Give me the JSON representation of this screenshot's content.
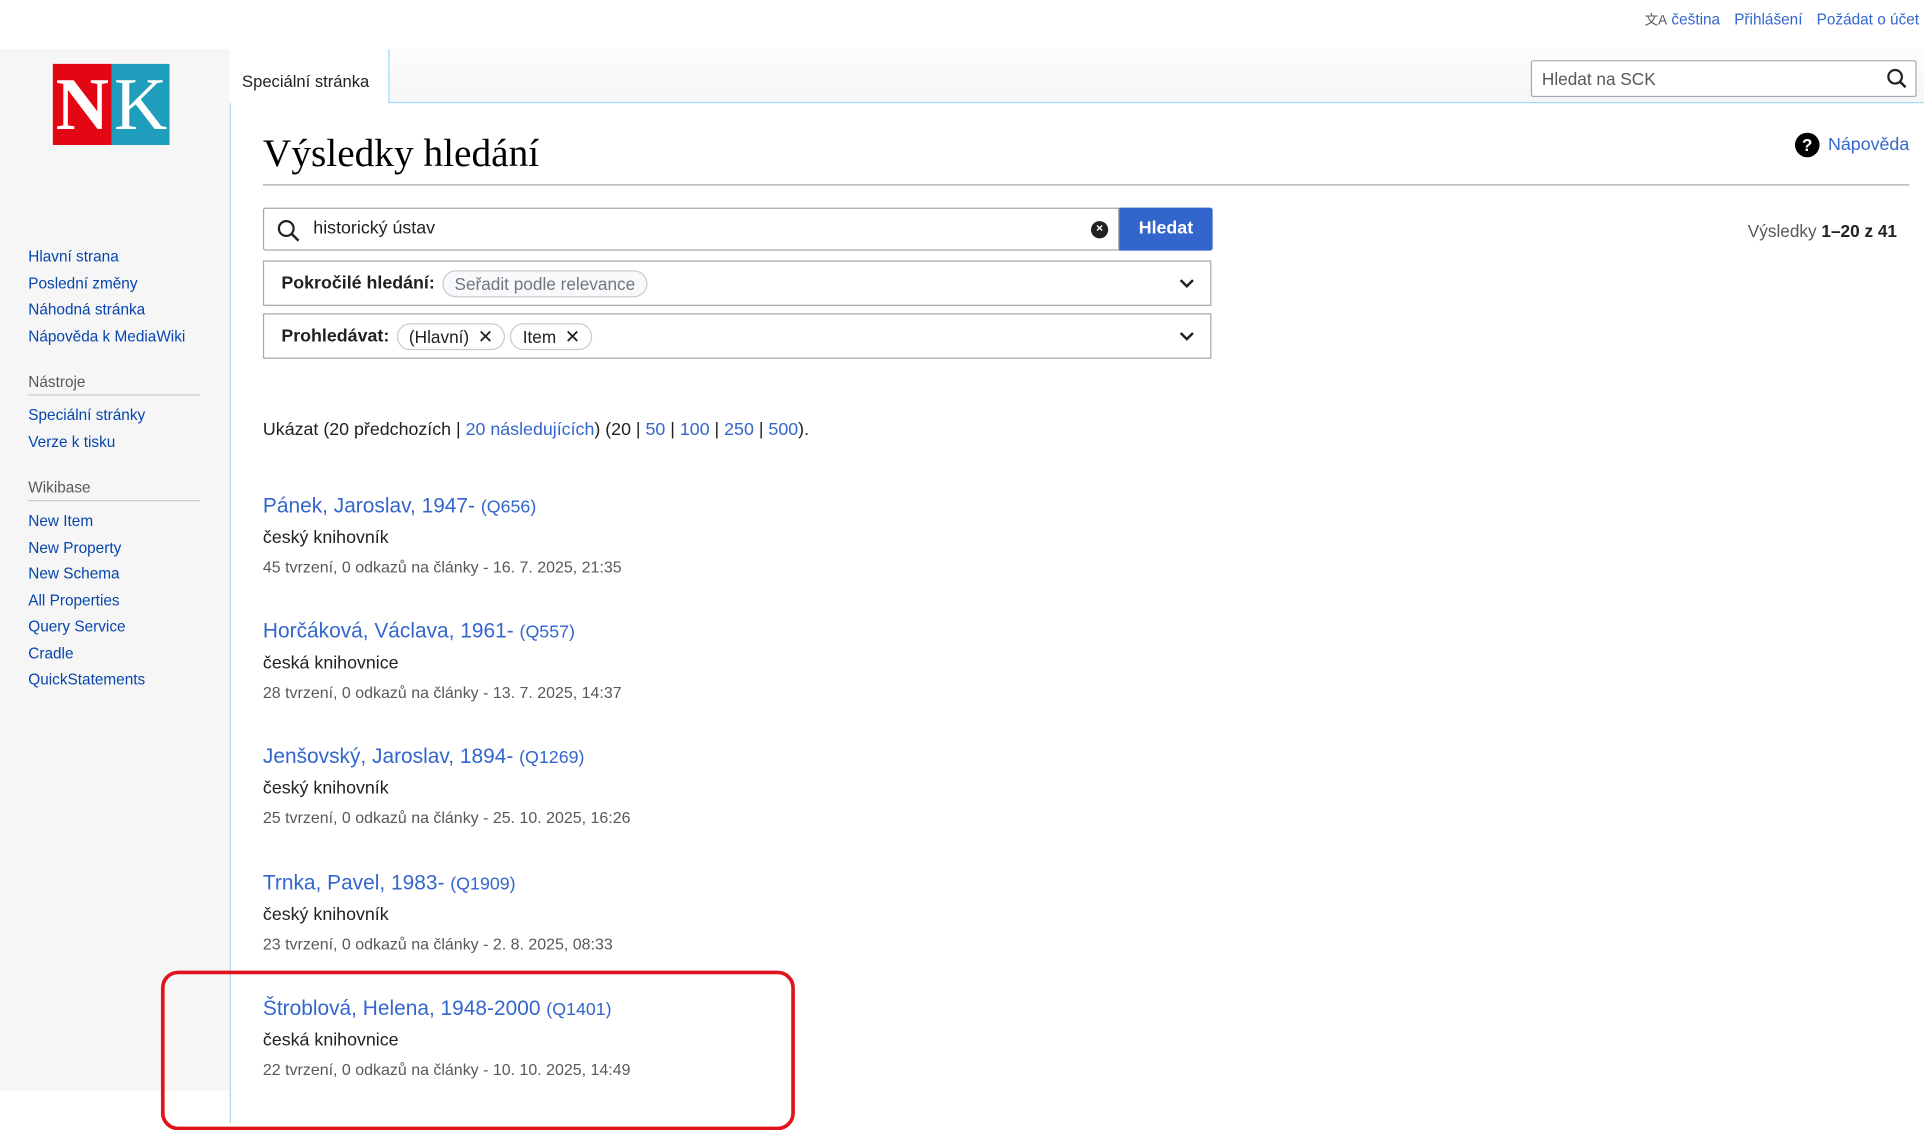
{
  "top_links": {
    "language": "čeština",
    "login": "Přihlášení",
    "request_account": "Požádat o účet"
  },
  "logo": {
    "left": "N",
    "right": "K"
  },
  "sidebar": {
    "nav": [
      "Hlavní strana",
      "Poslední změny",
      "Náhodná stránka",
      "Nápověda k MediaWiki"
    ],
    "tools_heading": "Nástroje",
    "tools": [
      "Speciální stránky",
      "Verze k tisku"
    ],
    "wikibase_heading": "Wikibase",
    "wikibase": [
      "New Item",
      "New Property",
      "New Schema",
      "All Properties",
      "Query Service",
      "Cradle",
      "QuickStatements"
    ]
  },
  "tab": {
    "label": "Speciální stránka"
  },
  "top_search": {
    "placeholder": "Hledat na SCK"
  },
  "page": {
    "title": "Výsledky hledání",
    "help": "Nápověda"
  },
  "search": {
    "query": "historický ústav",
    "button": "Hledat"
  },
  "advanced": {
    "label": "Pokročilé hledání:",
    "sort": "Seřadit podle relevance"
  },
  "namespaces": {
    "label": "Prohledávat:",
    "chips": [
      "(Hlavní)",
      "Item"
    ]
  },
  "results_count": {
    "prefix": "Výsledky ",
    "range": "1–20 z 41"
  },
  "pager": {
    "text_before": "Ukázat (20 předchozích | ",
    "next": "20 následujících",
    "text_mid": ") (20 | ",
    "sizes": [
      "50",
      "100",
      "250",
      "500"
    ],
    "text_end": ")."
  },
  "results": [
    {
      "title": "Pánek, Jaroslav, 1947-",
      "qid": "(Q656)",
      "desc": "český knihovník",
      "meta": "45 tvrzení, 0 odkazů na články - 16. 7. 2025, 21:35"
    },
    {
      "title": "Horčáková, Václava, 1961-",
      "qid": "(Q557)",
      "desc": "česká knihovnice",
      "meta": "28 tvrzení, 0 odkazů na články - 13. 7. 2025, 14:37"
    },
    {
      "title": "Jenšovský, Jaroslav, 1894-",
      "qid": "(Q1269)",
      "desc": "český knihovník",
      "meta": "25 tvrzení, 0 odkazů na články - 25. 10. 2025, 16:26"
    },
    {
      "title": "Trnka, Pavel, 1983-",
      "qid": "(Q1909)",
      "desc": "český knihovník",
      "meta": "23 tvrzení, 0 odkazů na články - 2. 8. 2025, 08:33"
    },
    {
      "title": "Štroblová, Helena, 1948-2000",
      "qid": "(Q1401)",
      "desc": "česká knihovnice",
      "meta": "22 tvrzení, 0 odkazů na články - 10. 10. 2025, 14:49"
    }
  ],
  "highlight_color": "#e0141e",
  "accent_color": "#3366cc"
}
